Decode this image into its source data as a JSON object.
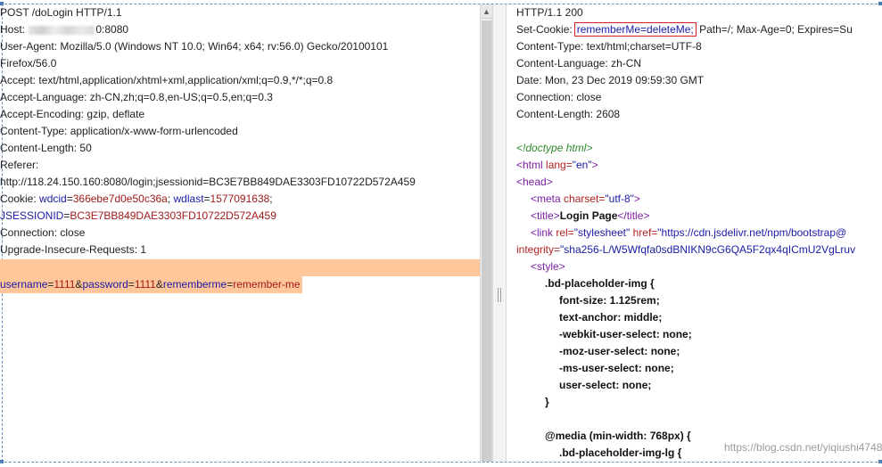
{
  "request": {
    "line1": "POST /doLogin HTTP/1.1",
    "host_label": "Host: ",
    "host_port": "0:8080",
    "user_agent_1": "User-Agent: Mozilla/5.0 (Windows NT 10.0; Win64; x64; rv:56.0) Gecko/20100101",
    "user_agent_2": "Firefox/56.0",
    "accept": "Accept: text/html,application/xhtml+xml,application/xml;q=0.9,*/*;q=0.8",
    "accept_language": "Accept-Language: zh-CN,zh;q=0.8,en-US;q=0.5,en;q=0.3",
    "accept_encoding": "Accept-Encoding: gzip, deflate",
    "content_type": "Content-Type: application/x-www-form-urlencoded",
    "content_length": "Content-Length: 50",
    "referer_label": "Referer:",
    "referer_url": "http://118.24.150.160:8080/login;jsessionid=BC3E7BB849DAE3303FD10722D572A459",
    "cookie_label": "Cookie: ",
    "cookie_wdcid_key": "wdcid",
    "cookie_wdcid_val": "366ebe7d0e50c36a",
    "cookie_sep1": "; ",
    "cookie_wdlast_key": "wdlast",
    "cookie_wdlast_val": "1577091638",
    "cookie_end": ";",
    "jsession_key": "JSESSIONID",
    "jsession_val": "BC3E7BB849DAE3303FD10722D572A459",
    "connection": "Connection: close",
    "upgrade": "Upgrade-Insecure-Requests: 1",
    "body": {
      "username_key": "username",
      "username_val": "1111",
      "password_key": "password",
      "password_val": "1111",
      "rememberme_key": "rememberme",
      "rememberme_val": "remember-me",
      "eq": "=",
      "amp": "&"
    }
  },
  "response": {
    "status": "HTTP/1.1 200",
    "set_cookie_label": "Set-Cookie:",
    "set_cookie_boxed": "rememberMe=deleteMe;",
    "set_cookie_rest": " Path=/; Max-Age=0; Expires=Su",
    "content_type": "Content-Type: text/html;charset=UTF-8",
    "content_language": "Content-Language: zh-CN",
    "date": "Date: Mon, 23 Dec 2019 09:59:30 GMT",
    "connection": "Connection: close",
    "content_length": "Content-Length: 2608",
    "doctype": "<!doctype html>",
    "html_open_tag": "<html",
    "html_lang_attr": " lang=",
    "html_lang_val": "\"en\"",
    "gt": ">",
    "head_tag": "<head>",
    "meta_tag": "<meta",
    "meta_attr": " charset=",
    "meta_val": "\"utf-8\"",
    "title_open": "<title>",
    "title_text": "Login Page",
    "title_close": "</title>",
    "link_tag": "<link",
    "link_rel_attr": " rel=",
    "link_rel_val": "\"stylesheet\"",
    "link_href_attr": " href=",
    "link_href_val": "\"https://cdn.jsdelivr.net/npm/bootstrap@",
    "integrity_attr": "integrity=",
    "integrity_val": "\"sha256-L/W5Wfqfa0sdBNIKN9cG6QA5F2qx4qICmU2VgLruv",
    "style_tag": "<style>",
    "css_selector": ".bd-placeholder-img {",
    "css_font_size": "font-size: 1.125rem;",
    "css_text_anchor": "text-anchor: middle;",
    "css_webkit": "-webkit-user-select: none;",
    "css_moz": "-moz-user-select: none;",
    "css_ms": "-ms-user-select: none;",
    "css_user_select": "user-select: none;",
    "css_close": "}",
    "css_media": "@media (min-width: 768px) {",
    "css_lg": ".bd-placeholder-img-lg {"
  },
  "watermark": "https://blog.csdn.net/yiqiushi4748",
  "scroll_up_glyph": "▲",
  "colors": {
    "highlight": "#ffc69a",
    "box_border": "#d42020",
    "key_blue": "#1a1aa6",
    "value_red": "#a11a1a",
    "comment_green": "#2f8a2f",
    "tag_purple": "#7a1fa2"
  }
}
